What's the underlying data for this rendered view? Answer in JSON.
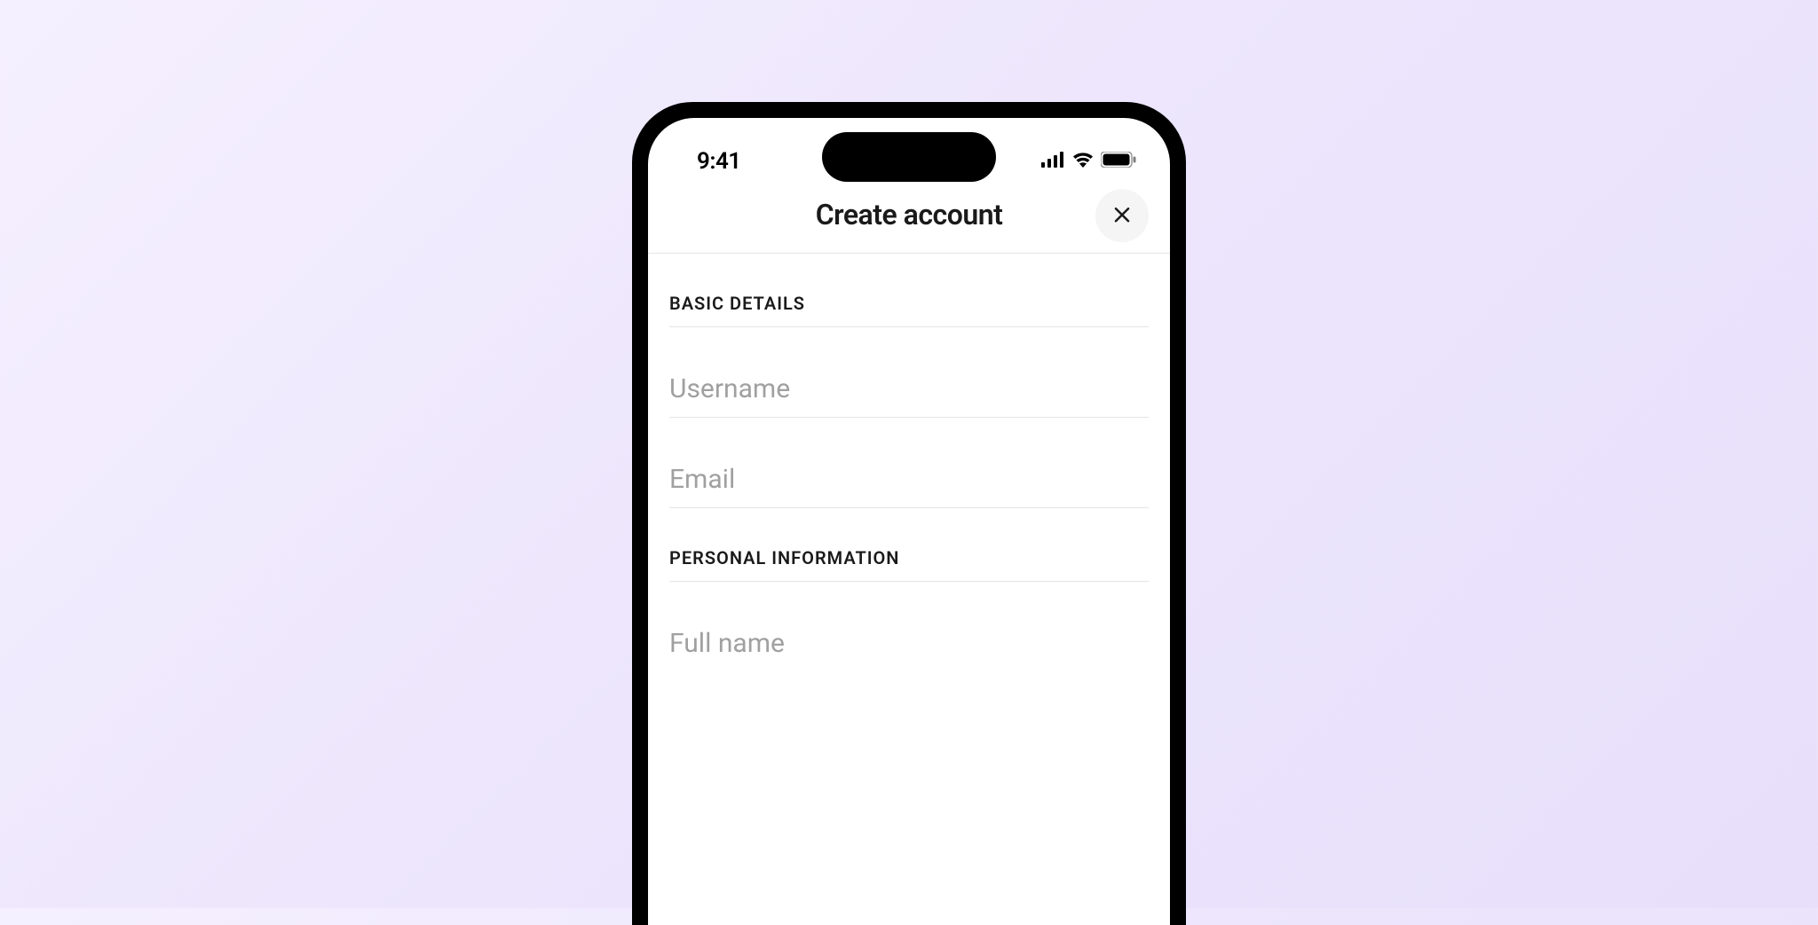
{
  "status_bar": {
    "time": "9:41"
  },
  "header": {
    "title": "Create account"
  },
  "sections": {
    "basic": {
      "label": "BASIC DETAILS",
      "fields": {
        "username": {
          "placeholder": "Username",
          "value": ""
        },
        "email": {
          "placeholder": "Email",
          "value": ""
        }
      }
    },
    "personal": {
      "label": "PERSONAL INFORMATION",
      "fields": {
        "fullname": {
          "placeholder": "Full name",
          "value": ""
        }
      }
    }
  }
}
